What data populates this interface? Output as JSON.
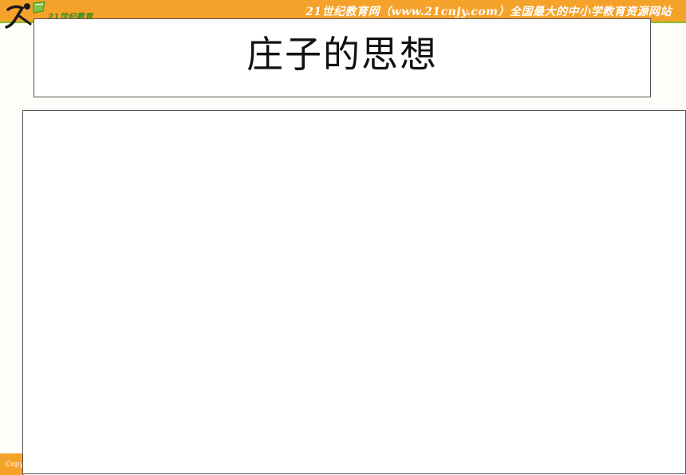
{
  "header": {
    "logo_text": "21世纪教育",
    "slogan": "21世纪教育网（www.21cnjy.com）全国最大的中小学教育资源网站"
  },
  "slide": {
    "title": "庄子的思想"
  },
  "footer": {
    "text": "Copyright"
  },
  "colors": {
    "header_orange": "#f5a22a",
    "header_green_line": "#8bbf2a",
    "logo_green": "#3a8a1d",
    "background": "#fefdf9"
  }
}
